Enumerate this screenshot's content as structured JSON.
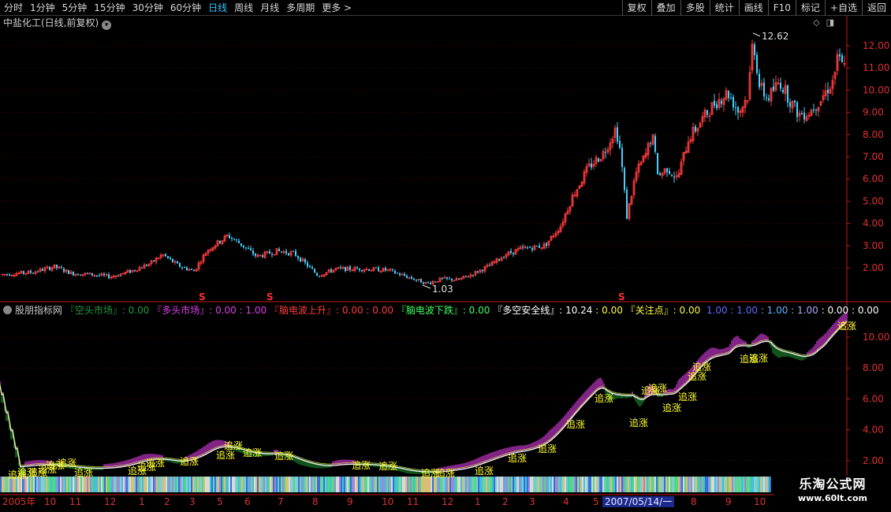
{
  "toolbar": {
    "periods": [
      {
        "label": "分时",
        "active": false
      },
      {
        "label": "1分钟",
        "active": false
      },
      {
        "label": "5分钟",
        "active": false
      },
      {
        "label": "15分钟",
        "active": false
      },
      {
        "label": "30分钟",
        "active": false
      },
      {
        "label": "60分钟",
        "active": false
      },
      {
        "label": "日线",
        "active": true
      },
      {
        "label": "周线",
        "active": false
      },
      {
        "label": "月线",
        "active": false
      },
      {
        "label": "多周期",
        "active": false
      },
      {
        "label": "更多 >",
        "active": false
      }
    ],
    "tools": [
      "复权",
      "叠加",
      "多股",
      "统计",
      "画线",
      "F10",
      "标记",
      "+自选",
      "返回"
    ]
  },
  "main_chart": {
    "title": "中盐化工(日线,前复权)",
    "high_label": "12.62",
    "low_label": "1.03",
    "markers": [
      "S",
      "S",
      "S"
    ],
    "y_ticks": [
      "12.00",
      "11.00",
      "10.00",
      "9.00",
      "8.00",
      "7.00",
      "6.00",
      "5.00",
      "4.00",
      "3.00",
      "2.00"
    ],
    "colors": {
      "up": "#ff3c3c",
      "down": "#46d2ff",
      "axis": "#c01818",
      "grid": "#5a0000"
    }
  },
  "sub_chart": {
    "legend": [
      {
        "text": "股朋指标网 ",
        "color": "#c8c8c8"
      },
      {
        "text": "『空头市场』: 0.00 ",
        "color": "#1f9a3a"
      },
      {
        "text": "『多头市场』: 0.00 : 1.00 ",
        "color": "#e040e8"
      },
      {
        "text": "『脑电波上升』: 0.00 : 0.00 ",
        "color": "#ff3c3c"
      },
      {
        "text": "『脑电波下跌』: 0.00 ",
        "color": "#40ff60"
      },
      {
        "text": "『多空安全线』: 10.24 ",
        "color": "#ffffff"
      },
      {
        "text": ": 0.00 ",
        "color": "#ffff40"
      },
      {
        "text": "『关注点』: 0.00 ",
        "color": "#ffff40"
      },
      {
        "text": " 1.00 ",
        "color": "#5a6cff"
      },
      {
        "text": ": 1.00 ",
        "color": "#5a6cff"
      },
      {
        "text": ": 1.00 ",
        "color": "#5ab4ff"
      },
      {
        "text": ": 1.00 ",
        "color": "#aaaaff"
      },
      {
        "text": ": 0.00 : 0.00",
        "color": "#ffffff"
      }
    ],
    "y_ticks": [
      "10.00",
      "8.00",
      "6.00",
      "4.00",
      "2.00"
    ],
    "signal_label": "追涨",
    "signal_count": 34
  },
  "date_axis": {
    "labels": [
      "2005年",
      "10",
      "11",
      "12",
      "1",
      "2",
      "3",
      "5",
      "6",
      "7",
      "8",
      "9",
      "10",
      "11",
      "12",
      "1",
      "2",
      "3",
      "4",
      "5",
      "8",
      "9",
      "10"
    ],
    "cursor": "2007/05/14/一"
  },
  "watermark": {
    "title": "乐淘公式网",
    "url": "www.60lt.com"
  }
}
